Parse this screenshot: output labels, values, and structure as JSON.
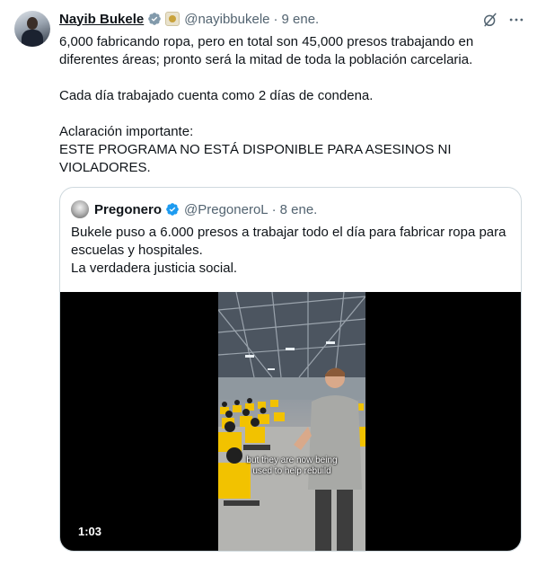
{
  "tweet": {
    "author_name": "Nayib Bukele",
    "handle": "@nayibbukele",
    "separator": "·",
    "date": "9 ene.",
    "paragraphs": [
      "6,000 fabricando ropa, pero en total son 45,000 presos trabajando en diferentes áreas; pronto será la mitad de toda la población carcelaria.",
      "Cada día trabajado cuenta como 2 días de condena.",
      "Aclaración importante:",
      "ESTE PROGRAMA NO ESTÁ DISPONIBLE PARA ASESINOS NI VIOLADORES."
    ],
    "icons": {
      "verified": "verified-badge-icon",
      "affiliate": "government-badge-icon",
      "grok": "grok-icon",
      "more": "more-icon"
    }
  },
  "quoted": {
    "author_name": "Pregonero",
    "handle": "@PregoneroL",
    "separator": "·",
    "date": "8 ene.",
    "lines": [
      "Bukele puso a 6.000 presos a trabajar todo el día para fabricar ropa para escuelas y hospitales.",
      "La verdadera justicia social."
    ],
    "video": {
      "caption_line1": "but they are now being",
      "caption_line2": "used to help rebuild",
      "duration": "1:03"
    }
  },
  "colors": {
    "text": "#0f1419",
    "muted": "#536471",
    "verified_blue": "#1d9bf0",
    "border": "#cfd9de",
    "shirt_yellow": "#f2c200"
  }
}
